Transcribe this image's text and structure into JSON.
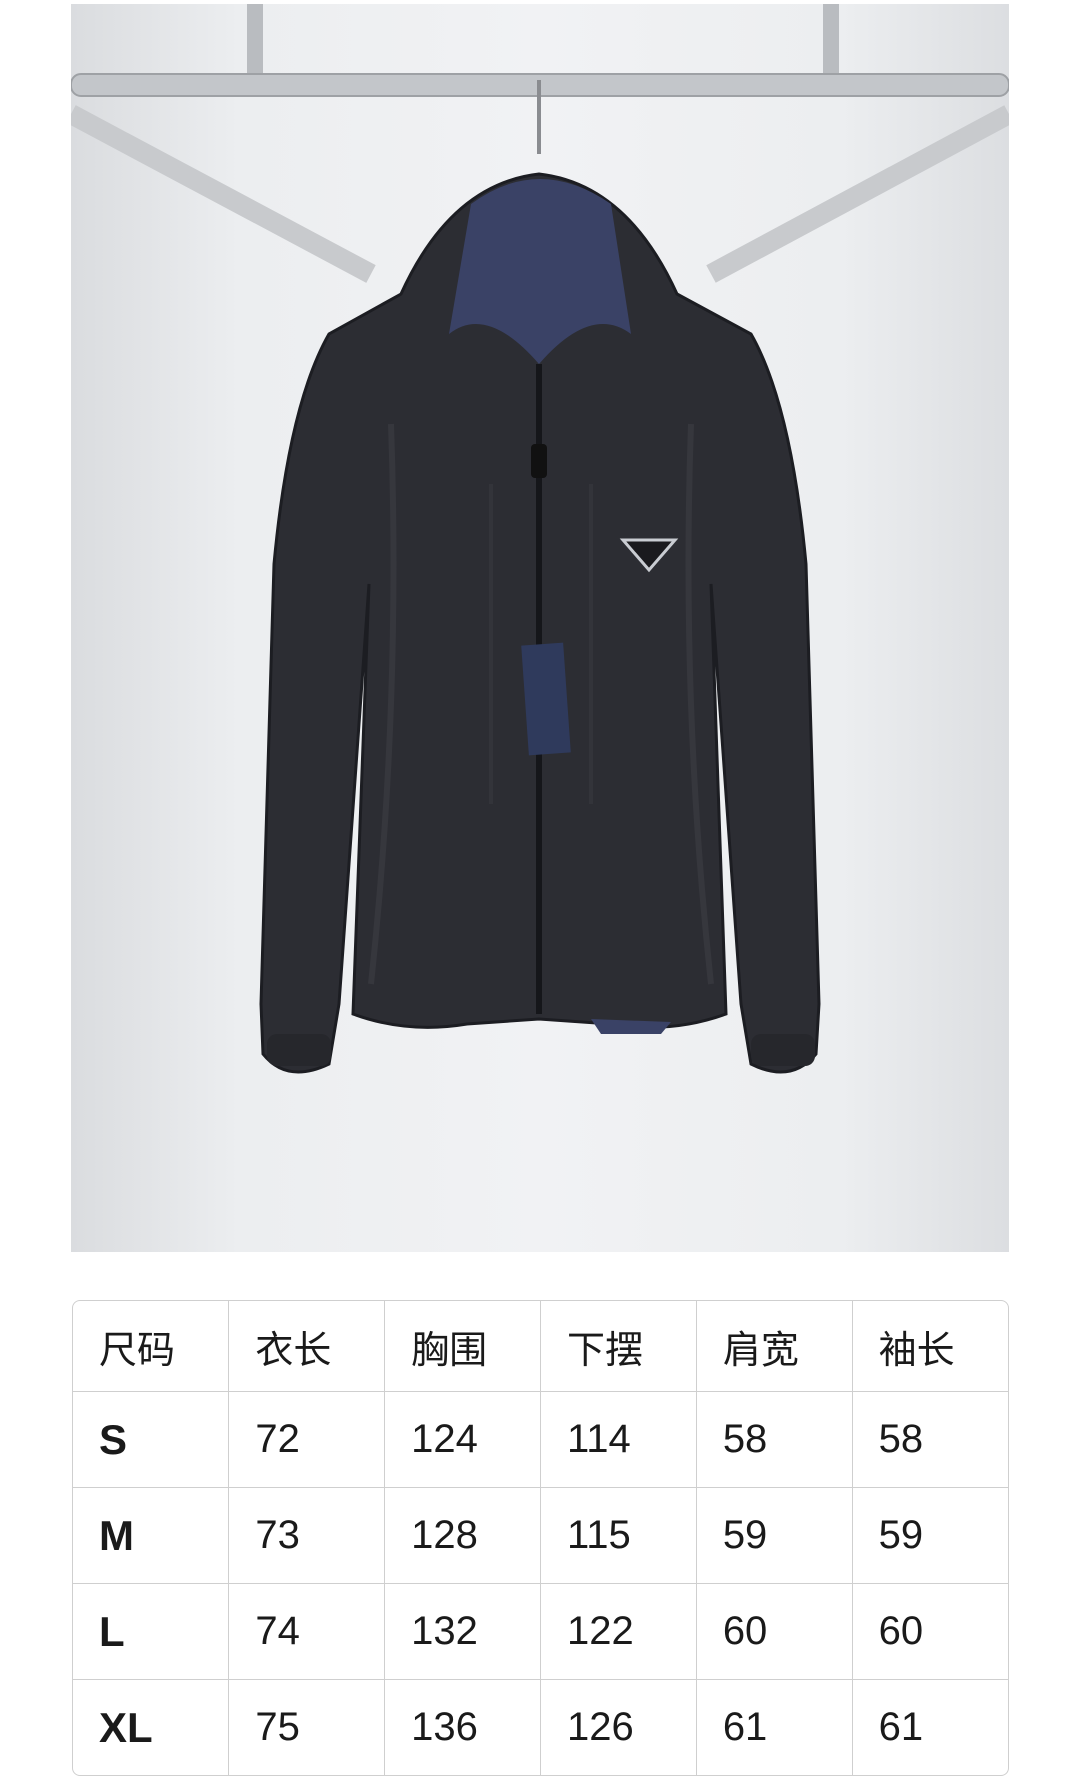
{
  "product_photo": {
    "alt_subject": "reversible hooded nylon jacket on hanger",
    "icon": "product-photo",
    "colors": {
      "jacket": "#2c2d33",
      "lining": "#3a4266",
      "background": "#eceef0"
    }
  },
  "size_chart": {
    "headers": [
      "尺码",
      "衣长",
      "胸围",
      "下摆",
      "肩宽",
      "袖长"
    ],
    "rows": [
      [
        "S",
        "72",
        "124",
        "114",
        "58",
        "58"
      ],
      [
        "M",
        "73",
        "128",
        "115",
        "59",
        "59"
      ],
      [
        "L",
        "74",
        "132",
        "122",
        "60",
        "60"
      ],
      [
        "XL",
        "75",
        "136",
        "126",
        "61",
        "61"
      ]
    ]
  }
}
